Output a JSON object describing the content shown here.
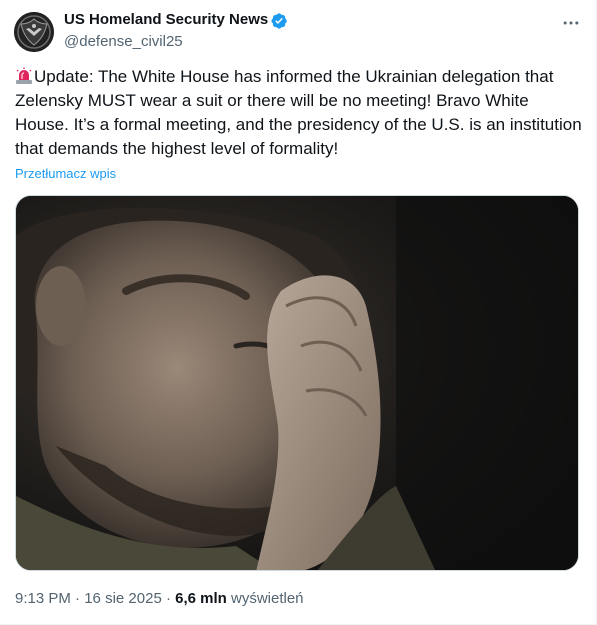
{
  "author": {
    "name": "US Homeland Security News",
    "handle": "@defense_civil25",
    "verified": true
  },
  "tweet": {
    "emoji": "siren-icon",
    "text": "Update: The White House has informed the Ukrainian delegation that Zelensky MUST wear a suit or there will be no meeting! Bravo White House. It’s a formal meeting, and the presidency of the U.S. is an institution that demands the highest level of formality!",
    "translate_label": "Przetłumacz wpis"
  },
  "meta": {
    "time": "9:13 PM",
    "separator": " · ",
    "date": "16 sie 2025",
    "views_count": "6,6 mln",
    "views_label": "wyświetleń"
  },
  "icons": {
    "more": "more-horizontal-icon",
    "verified": "verified-badge-icon"
  },
  "colors": {
    "link": "#1d9bf0",
    "verified": "#1d9bf0",
    "secondary_text": "#536471",
    "primary_text": "#0f1419"
  }
}
